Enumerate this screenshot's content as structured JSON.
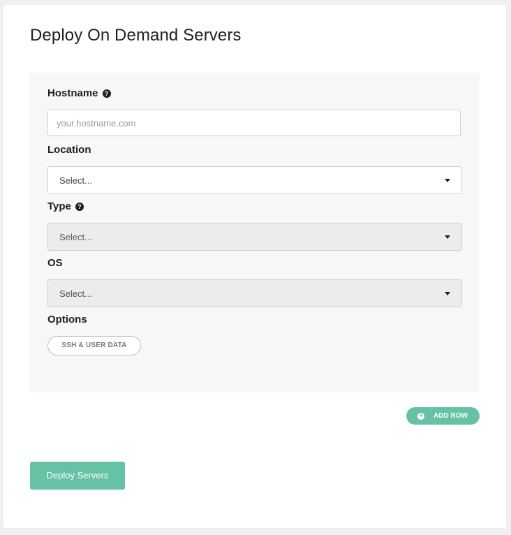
{
  "page": {
    "title": "Deploy On Demand Servers"
  },
  "form": {
    "hostname": {
      "label": "Hostname",
      "help_icon": "question-circle-icon",
      "placeholder": "your.hostname.com",
      "value": ""
    },
    "location": {
      "label": "Location",
      "selected": "Select..."
    },
    "type": {
      "label": "Type",
      "help_icon": "question-circle-icon",
      "selected": "Select..."
    },
    "os": {
      "label": "OS",
      "selected": "Select..."
    },
    "options": {
      "label": "Options",
      "button_label": "SSH & USER DATA"
    }
  },
  "actions": {
    "add_row_label": "ADD ROW",
    "add_row_icon": "plus-circle-icon",
    "deploy_label": "Deploy Servers"
  },
  "colors": {
    "accent": "#66c2a5",
    "panel_bg": "#f7f7f7",
    "disabled_select_bg": "#ececec"
  }
}
